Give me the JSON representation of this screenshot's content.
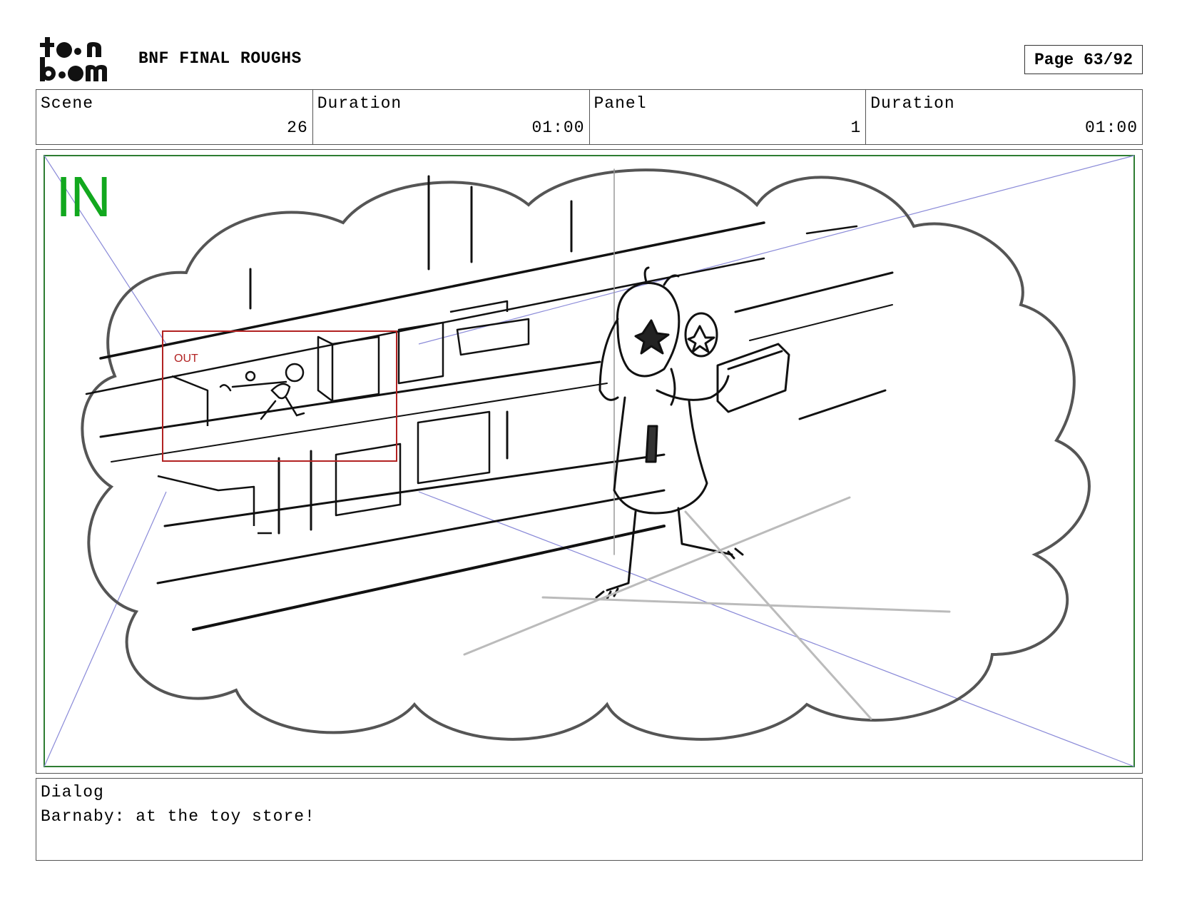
{
  "header": {
    "logo_text": "toonboom",
    "title": "BNF FINAL ROUGHS",
    "page": "Page 63/92"
  },
  "info": {
    "scene_label": "Scene",
    "scene_value": "26",
    "duration_label": "Duration",
    "duration_value": "01:00",
    "panel_label": "Panel",
    "panel_value": "1",
    "panel_duration_label": "Duration",
    "panel_duration_value": "01:00"
  },
  "panel": {
    "in_label": "IN",
    "out_label": "OUT",
    "colors": {
      "in_frame": "#12a81e",
      "out_frame": "#b22222",
      "guides": "#8a8ad8"
    }
  },
  "dialog": {
    "label": "Dialog",
    "text": "Barnaby: at the toy store!"
  }
}
